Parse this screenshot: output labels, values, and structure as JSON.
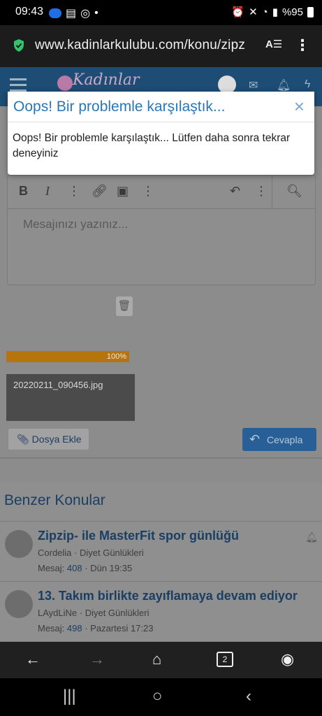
{
  "status_bar": {
    "time": "09:43",
    "battery_text": "%95",
    "icons": [
      "samsung-badge-icon",
      "message-icon",
      "whatsapp-icon",
      "dot-icon",
      "alarm-icon",
      "mute-icon",
      "wifi-icon",
      "signal-icon",
      "battery-icon"
    ]
  },
  "browser": {
    "url": "www.kadinlarkulubu.com/konu/zipz",
    "icons": [
      "shield-check-icon",
      "reader-mode-icon",
      "more-vert-icon"
    ]
  },
  "site_header": {
    "logo_text": "Kadınlar",
    "icons": [
      "menu-icon",
      "avatar",
      "mail-icon",
      "bell-icon",
      "bolt-icon"
    ]
  },
  "modal": {
    "title": "Oops! Bir problemle karşılaştık...",
    "close": "×",
    "message": "Oops! Bir problemle karşılaştık... Lütfen daha sonra tekrar deneyiniz"
  },
  "editor": {
    "placeholder": "Mesajınızı yazınız...",
    "toolbar": {
      "bold": "B",
      "italic": "I",
      "more": "⋮"
    }
  },
  "upload": {
    "progress_label": "100%",
    "progress_value": 1.0,
    "file_name": "20220211_090456.jpg"
  },
  "buttons": {
    "attach": "Dosya Ekle",
    "reply": "Cevapla"
  },
  "similar": {
    "heading": "Benzer Konular",
    "threads": [
      {
        "title": "Zipzip- ile MasterFit spor günlüğü",
        "author": "Cordelia",
        "forum": "Diyet Günlükleri",
        "replies_label": "Mesaj:",
        "replies": "408",
        "time": "Dün 19:35"
      },
      {
        "title": "13. Takım birlikte zayıflamaya devam ediyor",
        "author": "LAydLiNe",
        "forum": "Diyet Günlükleri",
        "replies_label": "Mesaj:",
        "replies": "498",
        "time": "Pazartesi 17:23"
      }
    ]
  },
  "bottom_nav": {
    "tab_count": "2",
    "icons": [
      "back-arrow-icon",
      "forward-arrow-icon",
      "home-icon",
      "tabs-icon",
      "account-icon"
    ]
  },
  "system_nav": {
    "icons": [
      "recents-icon",
      "home-circle-icon",
      "system-back-icon"
    ]
  }
}
